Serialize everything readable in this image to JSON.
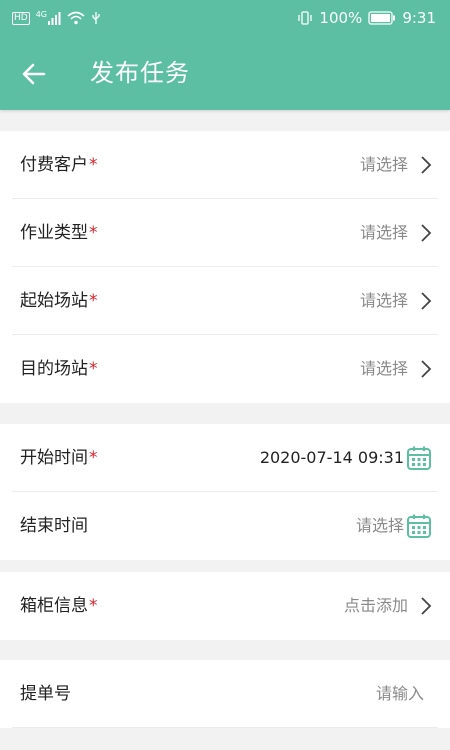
{
  "status_bar": {
    "network_left": "HD",
    "network_type": "4G",
    "battery": "100%",
    "time": "9:31"
  },
  "header": {
    "title": "发布任务",
    "back_icon": "back-arrow-icon"
  },
  "colors": {
    "primary": "#5cbfa3",
    "required": "#d9232a",
    "placeholder": "#8a8a8a"
  },
  "sections": [
    {
      "rows": [
        {
          "label": "付费客户",
          "required": "*",
          "value": "请选择",
          "icon": "chevron-right-icon"
        },
        {
          "label": "作业类型",
          "required": "*",
          "value": "请选择",
          "icon": "chevron-right-icon"
        },
        {
          "label": "起始场站",
          "required": "*",
          "value": "请选择",
          "icon": "chevron-right-icon"
        },
        {
          "label": "目的场站",
          "required": "*",
          "value": "请选择",
          "icon": "chevron-right-icon"
        }
      ]
    },
    {
      "rows": [
        {
          "label": "开始时间",
          "required": "*",
          "value": "2020-07-14 09:31",
          "icon": "calendar-icon"
        },
        {
          "label": "结束时间",
          "value": "请选择",
          "icon": "calendar-icon"
        }
      ]
    },
    {
      "rows": [
        {
          "label": "箱柜信息",
          "required": "*",
          "value": "点击添加",
          "icon": "chevron-right-icon"
        }
      ]
    },
    {
      "rows": [
        {
          "label": "提单号",
          "placeholder": "请输入"
        }
      ]
    }
  ]
}
